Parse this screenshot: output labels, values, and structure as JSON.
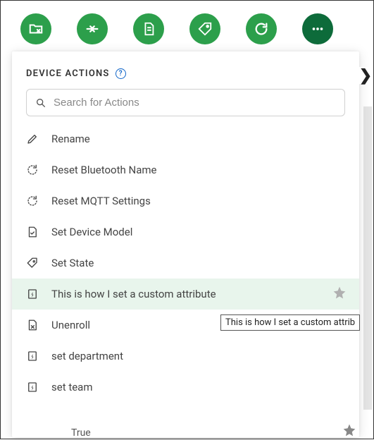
{
  "toolbar": {
    "buttons": [
      "folder-remove",
      "merge",
      "document",
      "tag",
      "refresh",
      "more"
    ]
  },
  "panel": {
    "title": "DEVICE ACTIONS",
    "search_placeholder": "Search for Actions",
    "actions": [
      {
        "icon": "pencil",
        "label": "Rename",
        "selected": false
      },
      {
        "icon": "reset-dots",
        "label": "Reset Bluetooth Name",
        "selected": false
      },
      {
        "icon": "reset-dots",
        "label": "Reset MQTT Settings",
        "selected": false
      },
      {
        "icon": "doc-check",
        "label": "Set Device Model",
        "selected": false
      },
      {
        "icon": "tag-outline",
        "label": "Set State",
        "selected": false
      },
      {
        "icon": "bolt",
        "label": "This is how I set a custom attribute",
        "selected": true,
        "starred": true
      },
      {
        "icon": "doc-x",
        "label": "Unenroll",
        "selected": false
      },
      {
        "icon": "bolt",
        "label": "set department",
        "selected": false
      },
      {
        "icon": "bolt",
        "label": "set team",
        "selected": false
      }
    ]
  },
  "tooltip_text": "This is how I set a custom attrib",
  "bottom_text": "True"
}
